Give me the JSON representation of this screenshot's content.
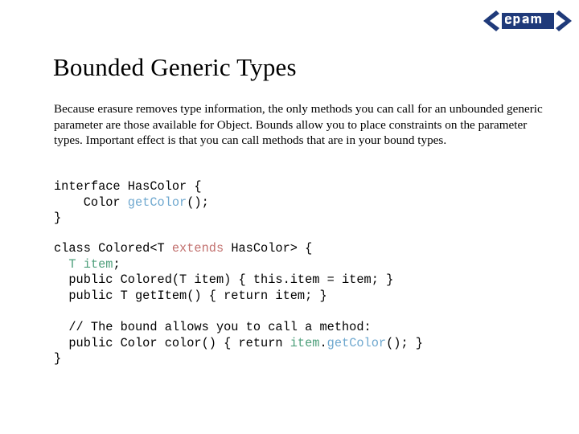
{
  "slide": {
    "background_color": "#ffffff",
    "logo": {
      "name": "epam-logo",
      "text": "<epam>",
      "color": "#1f3a7a"
    },
    "title": "Bounded Generic Types",
    "body_paragraph": "Because erasure removes type information, the only methods you can call for an unbounded generic parameter are those available for Object. Bounds allow you to place constraints on the parameter types. Important effect is that you can call methods that are in your bound types.",
    "code_colors": {
      "default": "#000000",
      "method": "#6fa8cf",
      "keyword": "#c2706e",
      "type": "#4fa07c"
    },
    "code_block_1": {
      "lines": [
        [
          {
            "text": "interface HasColor {",
            "style": "default"
          }
        ],
        [
          {
            "text": "    Color ",
            "style": "default"
          },
          {
            "text": "getColor",
            "style": "method"
          },
          {
            "text": "();",
            "style": "default"
          }
        ],
        [
          {
            "text": "}",
            "style": "default"
          }
        ]
      ]
    },
    "code_block_2": {
      "lines": [
        [
          {
            "text": "class Colored<T ",
            "style": "default"
          },
          {
            "text": "extends",
            "style": "keyword"
          },
          {
            "text": " HasColor> {",
            "style": "default"
          }
        ],
        [
          {
            "text": "  ",
            "style": "default"
          },
          {
            "text": "T item",
            "style": "type"
          },
          {
            "text": ";",
            "style": "default"
          }
        ],
        [
          {
            "text": "  public Colored(T item) { this.item = item; }",
            "style": "default"
          }
        ],
        [
          {
            "text": "  public T getItem() { return item; }",
            "style": "default"
          }
        ],
        [
          {
            "text": "",
            "style": "default"
          }
        ],
        [
          {
            "text": "  // The bound allows you to call a method:",
            "style": "default"
          }
        ],
        [
          {
            "text": "  public Color color() { return ",
            "style": "default"
          },
          {
            "text": "item",
            "style": "type"
          },
          {
            "text": ".",
            "style": "default"
          },
          {
            "text": "getColor",
            "style": "method"
          },
          {
            "text": "(); }",
            "style": "default"
          }
        ],
        [
          {
            "text": "}",
            "style": "default"
          }
        ]
      ]
    }
  }
}
